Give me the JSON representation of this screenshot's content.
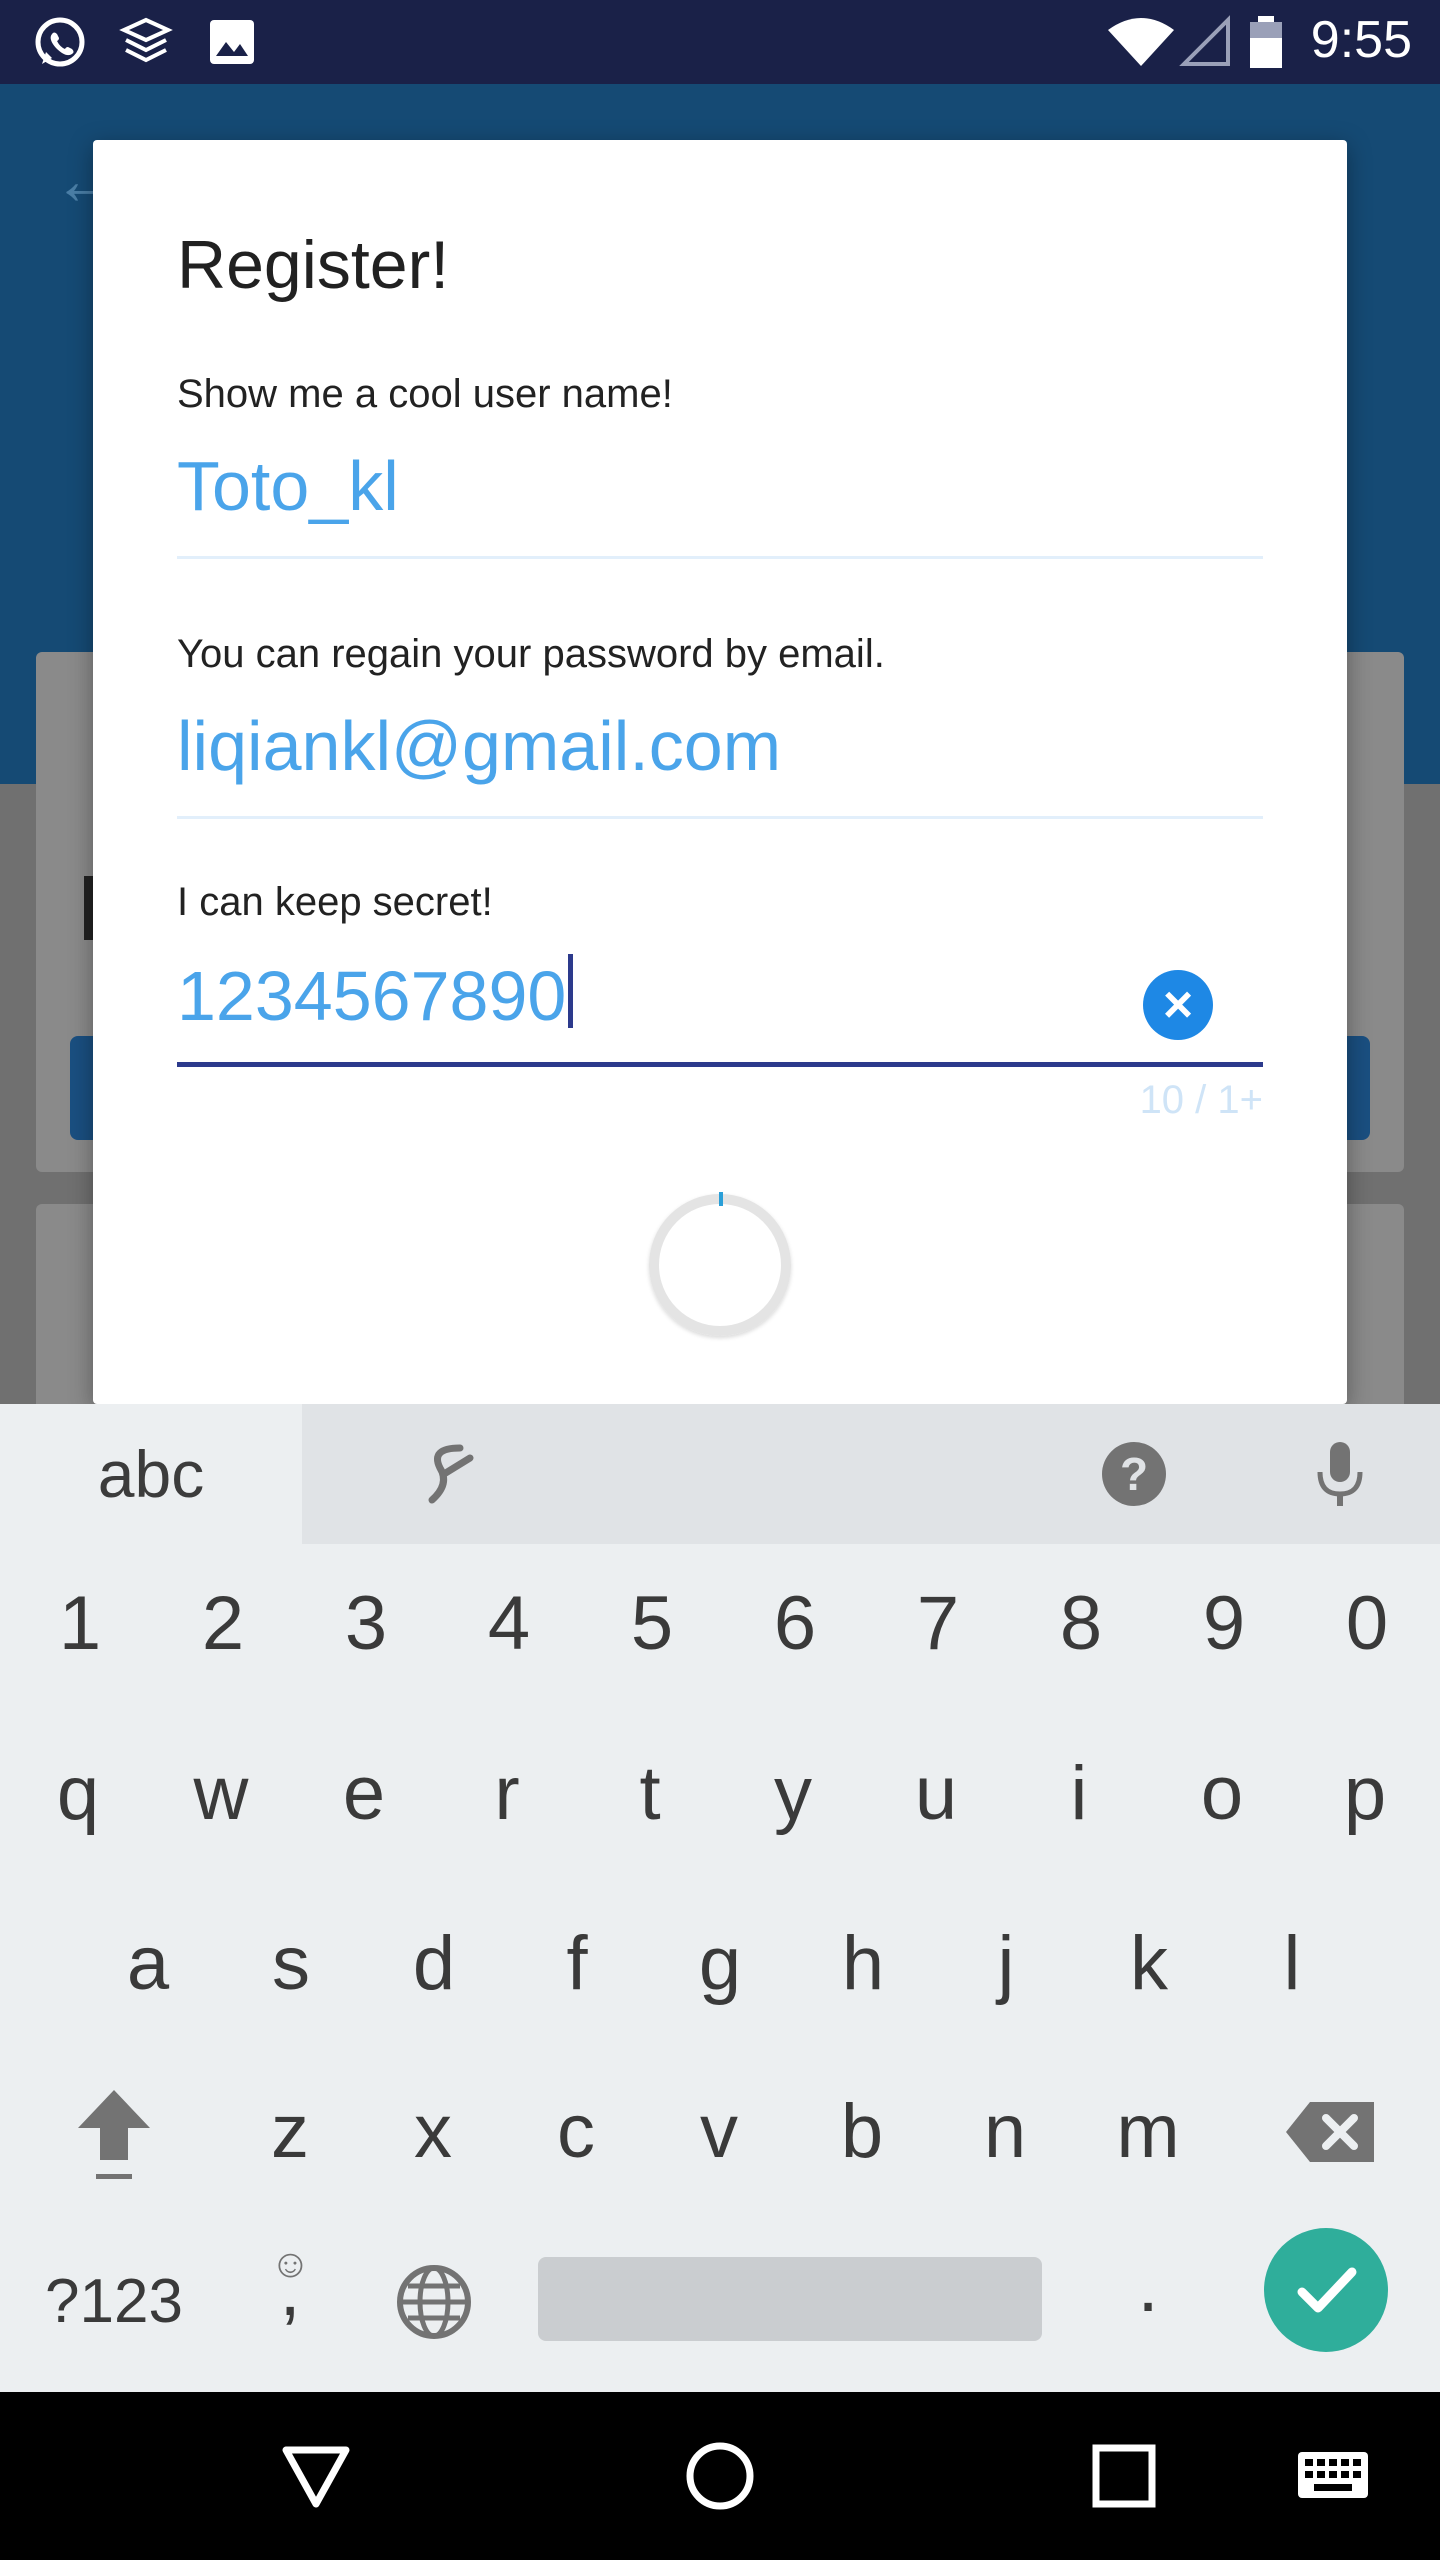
{
  "status_bar": {
    "time": "9:55",
    "left_icons": [
      "whatsapp-icon",
      "layers-app-icon",
      "image-icon"
    ],
    "right_icons": [
      "wifi-icon",
      "signal-icon",
      "battery-icon"
    ]
  },
  "dialog": {
    "title": "Register!",
    "username": {
      "label": "Show me a cool user name!",
      "value": "Toto_kl"
    },
    "email": {
      "label": "You can regain your password by email.",
      "value": "liqiankl@gmail.com"
    },
    "password": {
      "label": "I can keep secret!",
      "value": "1234567890",
      "counter": "10 / 1+"
    }
  },
  "colors": {
    "accent": "#4aa4ea",
    "active_underline": "#2c3a8c",
    "app_bar": "#154a74",
    "status_bar": "#1a2148",
    "enter_key": "#2fae9b"
  },
  "keyboard": {
    "toolbar": {
      "mode": "abc"
    },
    "row_numbers": [
      "1",
      "2",
      "3",
      "4",
      "5",
      "6",
      "7",
      "8",
      "9",
      "0"
    ],
    "row1": [
      "q",
      "w",
      "e",
      "r",
      "t",
      "y",
      "u",
      "i",
      "o",
      "p"
    ],
    "row2": [
      "a",
      "s",
      "d",
      "f",
      "g",
      "h",
      "j",
      "k",
      "l"
    ],
    "row3": [
      "z",
      "x",
      "c",
      "v",
      "b",
      "n",
      "m"
    ],
    "bottom": {
      "symbols": "?123",
      "emoji_comma": ",",
      "period": "."
    }
  },
  "navigation_bar": {
    "icons": [
      "back-triangle-icon",
      "home-circle-icon",
      "recents-square-icon",
      "keyboard-switch-icon"
    ]
  }
}
